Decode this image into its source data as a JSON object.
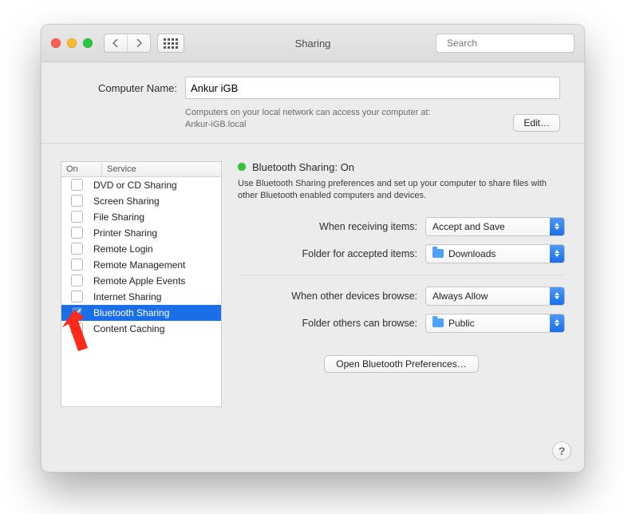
{
  "window_title": "Sharing",
  "search_placeholder": "Search",
  "computer_name_label": "Computer Name:",
  "computer_name_value": "Ankur iGB",
  "hint_line1": "Computers on your local network can access your computer at:",
  "hint_line2": "Ankur-iGB.local",
  "edit_label": "Edit…",
  "table": {
    "col_on": "On",
    "col_service": "Service"
  },
  "services": [
    {
      "label": "DVD or CD Sharing",
      "on": false,
      "selected": false
    },
    {
      "label": "Screen Sharing",
      "on": false,
      "selected": false
    },
    {
      "label": "File Sharing",
      "on": false,
      "selected": false
    },
    {
      "label": "Printer Sharing",
      "on": false,
      "selected": false
    },
    {
      "label": "Remote Login",
      "on": false,
      "selected": false
    },
    {
      "label": "Remote Management",
      "on": false,
      "selected": false
    },
    {
      "label": "Remote Apple Events",
      "on": false,
      "selected": false
    },
    {
      "label": "Internet Sharing",
      "on": false,
      "selected": false
    },
    {
      "label": "Bluetooth Sharing",
      "on": true,
      "selected": true
    },
    {
      "label": "Content Caching",
      "on": false,
      "selected": false
    }
  ],
  "status_text": "Bluetooth Sharing: On",
  "description": "Use Bluetooth Sharing preferences and set up your computer to share files with other Bluetooth enabled computers and devices.",
  "fields": {
    "receiving_label": "When receiving items:",
    "receiving_value": "Accept and Save",
    "accepted_folder_label": "Folder for accepted items:",
    "accepted_folder_value": "Downloads",
    "browse_label": "When other devices browse:",
    "browse_value": "Always Allow",
    "browse_folder_label": "Folder others can browse:",
    "browse_folder_value": "Public"
  },
  "open_prefs_label": "Open Bluetooth Preferences…",
  "help_label": "?"
}
